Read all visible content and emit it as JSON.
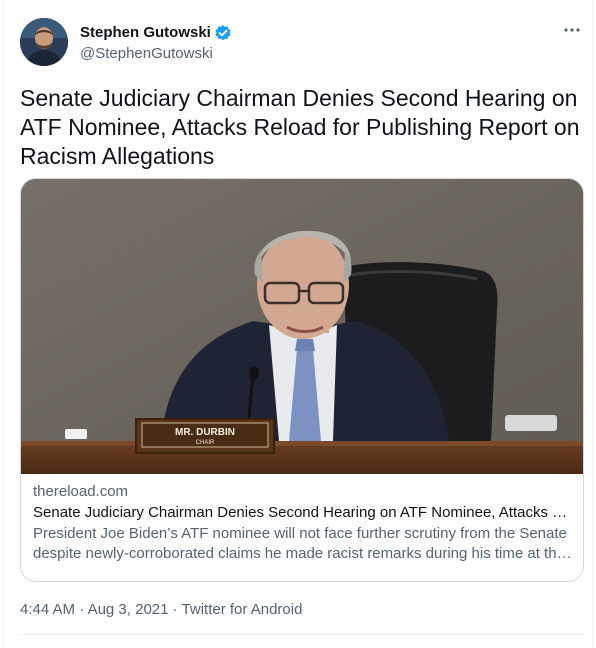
{
  "author": {
    "display_name": "Stephen Gutowski",
    "handle": "@StephenGutowski",
    "verified": true
  },
  "icons": {
    "verified": "verified-badge-icon",
    "more": "more-options-icon"
  },
  "tweet": {
    "text": "Senate Judiciary Chairman Denies Second Hearing on ATF Nominee, Attacks Reload for Publishing Report on Racism Allegations"
  },
  "card": {
    "image_caption": {
      "line1": "MR. DURBIN",
      "line2": "CHAIR"
    },
    "domain": "thereload.com",
    "title": "Senate Judiciary Chairman Denies Second Hearing on ATF Nominee, Attacks Reload for Publishing Report on Racism Allegations",
    "description_line1": "President Joe Biden’s ATF nominee will not face further scrutiny from the Senate",
    "description_line2": "despite newly-corroborated claims he made racist remarks during his time at the ATF..."
  },
  "meta": {
    "time": "4:44 AM",
    "date": "Aug 3, 2021",
    "source": "Twitter for Android",
    "separator": " · "
  },
  "colors": {
    "accent": "#1d9bf0",
    "text": "#0f1419",
    "secondary": "#536471",
    "border": "#cfd9de"
  }
}
